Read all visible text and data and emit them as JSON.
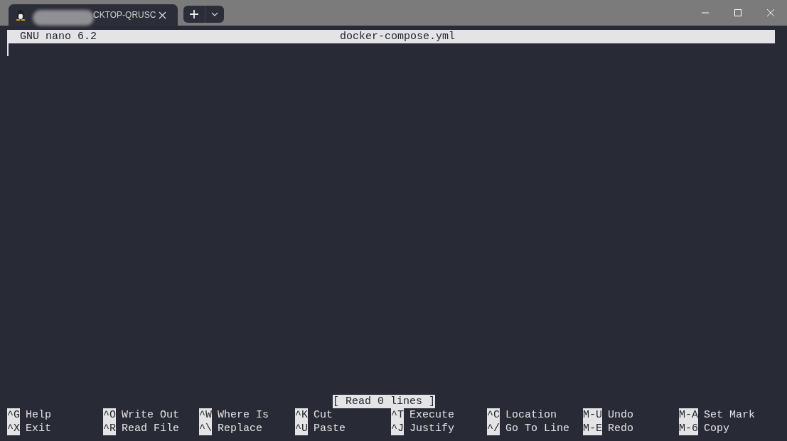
{
  "window": {
    "tab": {
      "title": "CKTOP-QRUSC",
      "redacted": true
    }
  },
  "header": {
    "app": "GNU nano 6.2",
    "file": "docker-compose.yml"
  },
  "status": "[ Read 0 lines ]",
  "shortcut_rows": [
    [
      {
        "key": "^G",
        "label": "Help"
      },
      {
        "key": "^O",
        "label": "Write Out"
      },
      {
        "key": "^W",
        "label": "Where Is"
      },
      {
        "key": "^K",
        "label": "Cut"
      },
      {
        "key": "^T",
        "label": "Execute"
      },
      {
        "key": "^C",
        "label": "Location"
      },
      {
        "key": "M-U",
        "label": "Undo"
      },
      {
        "key": "M-A",
        "label": "Set Mark"
      }
    ],
    [
      {
        "key": "^X",
        "label": "Exit"
      },
      {
        "key": "^R",
        "label": "Read File"
      },
      {
        "key": "^\\",
        "label": "Replace"
      },
      {
        "key": "^U",
        "label": "Paste"
      },
      {
        "key": "^J",
        "label": "Justify"
      },
      {
        "key": "^/",
        "label": "Go To Line"
      },
      {
        "key": "M-E",
        "label": "Redo"
      },
      {
        "key": "M-6",
        "label": "Copy"
      }
    ]
  ]
}
